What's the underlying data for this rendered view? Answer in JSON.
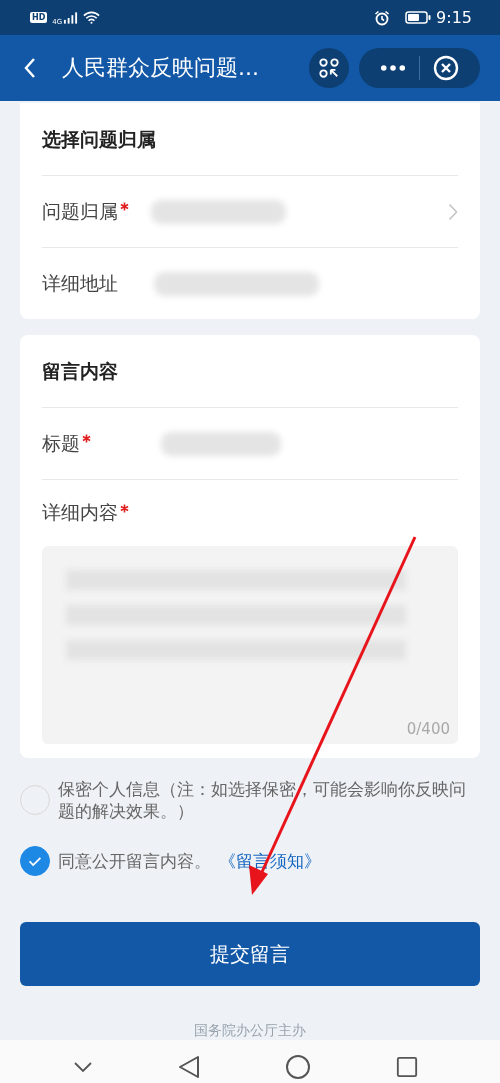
{
  "status_bar": {
    "badge": "HD",
    "network": "4G",
    "time": "9:15"
  },
  "header": {
    "title": "人民群众反映问题..."
  },
  "sections": [
    {
      "title": "选择问题归属",
      "fields": [
        {
          "label": "问题归属",
          "required": true,
          "kind": "select"
        },
        {
          "label": "详细地址",
          "required": false,
          "kind": "text"
        }
      ]
    },
    {
      "title": "留言内容",
      "fields": [
        {
          "label": "标题",
          "required": true,
          "kind": "text"
        },
        {
          "label": "详细内容",
          "required": true,
          "kind": "textarea",
          "counter": "0/400"
        }
      ]
    }
  ],
  "options": [
    {
      "text": "保密个人信息（注：如选择保密，可能会影响你反映问题的解决效果。）",
      "checked": false
    },
    {
      "text": "同意公开留言内容。",
      "checked": true,
      "link": "《留言须知》"
    }
  ],
  "submit": "提交留言",
  "footer": "国务院办公厅主办"
}
